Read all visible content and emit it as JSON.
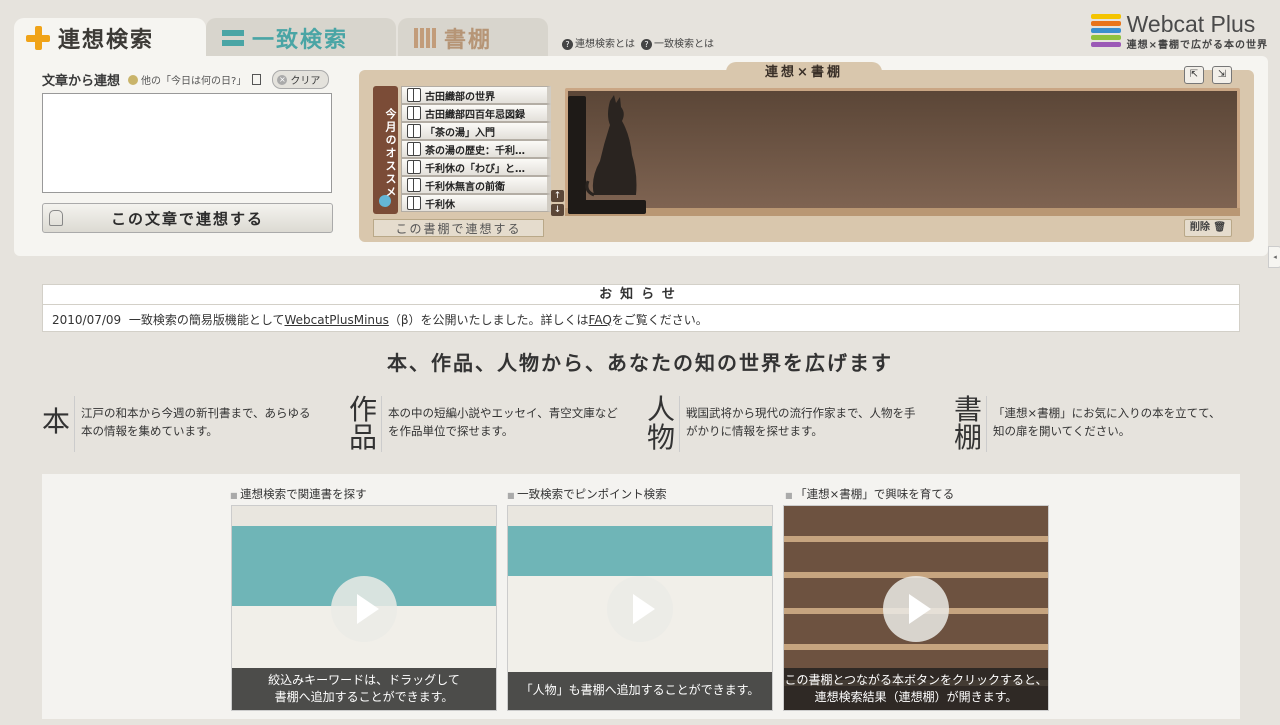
{
  "tabs": [
    {
      "label": "連想検索"
    },
    {
      "label": "一致検索"
    },
    {
      "label": "書棚"
    }
  ],
  "help": {
    "about_rensou": "連想検索とは",
    "about_itchi": "一致検索とは"
  },
  "logo": {
    "name": "Webcat Plus",
    "tagline": "連想×書棚で広がる本の世界",
    "colors": [
      "#f4c400",
      "#e8741b",
      "#3b8fcf",
      "#8fc13e",
      "#9b59b6"
    ]
  },
  "assoc": {
    "heading": "文章から連想",
    "other_link": "他の「今日は何の日?」",
    "clear": "クリア",
    "button": "この文章で連想する",
    "input_value": ""
  },
  "shelf": {
    "title": "連想×書棚",
    "recommend_label": "今月のオススメ",
    "books": [
      "古田織部の世界",
      "古田織部四百年忌図録",
      "「茶の湯」入門",
      "茶の湯の歴史：千利…",
      "千利休の「わび」と…",
      "千利休無言の前衛",
      "千利休"
    ],
    "assoc_button": "この書棚で連想する",
    "delete_button": "削除"
  },
  "notice": {
    "title": "お知らせ",
    "date": "2010/07/09",
    "text_before": "一致検索の簡易版機能として",
    "link1": "WebcatPlusMinus",
    "text_mid": "（β）を公開いたしました。詳しくは",
    "link2": "FAQ",
    "text_after": "をご覧ください。"
  },
  "tagline": "本、作品、人物から、あなたの知の世界を広げます",
  "features": [
    {
      "char": "本",
      "text": "江戸の和本から今週の新刊書まで、あらゆる本の情報を集めています。"
    },
    {
      "char": "作品",
      "text": "本の中の短編小説やエッセイ、青空文庫などを作品単位で探せます。"
    },
    {
      "char": "人物",
      "text": "戦国武将から現代の流行作家まで、人物を手がかりに情報を探せます。"
    },
    {
      "char": "書棚",
      "text": "「連想×書棚」にお気に入りの本を立てて、知の扉を開いてください。"
    }
  ],
  "videos": [
    {
      "caption": "連想検索で関連書を探す",
      "subtitle1": "絞込みキーワードは、ドラッグして",
      "subtitle2": "書棚へ追加することができます。"
    },
    {
      "caption": "一致検索でピンポイント検索",
      "subtitle1": "「人物」も書棚へ追加することができます。",
      "subtitle2": ""
    },
    {
      "caption": "「連想×書棚」で興味を育てる",
      "subtitle1": "この書棚とつながる本ボタンをクリックすると、",
      "subtitle2": "連想検索結果（連想棚）が開きます。"
    }
  ]
}
